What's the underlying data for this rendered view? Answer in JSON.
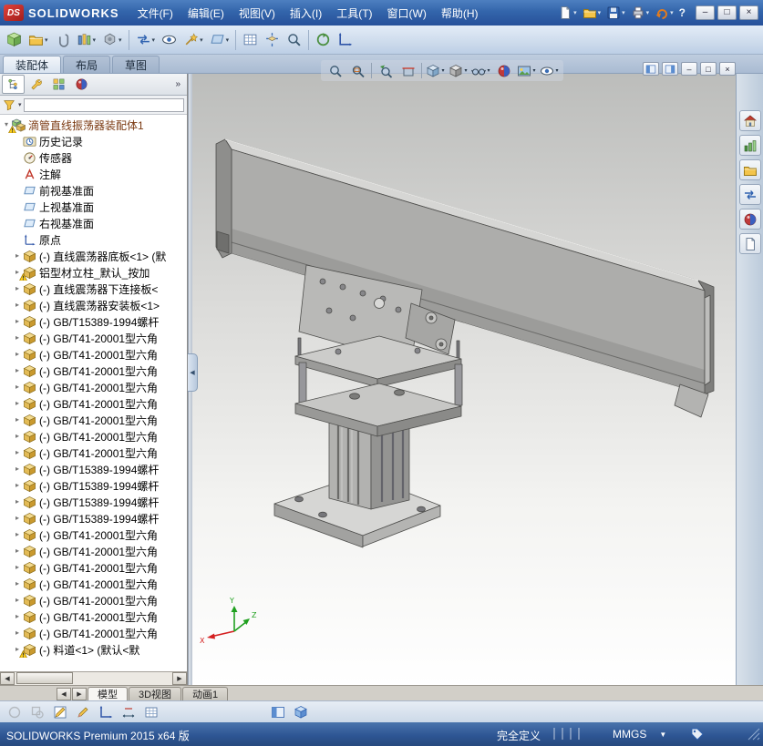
{
  "colors": {
    "titlebar_blue": "#33609f",
    "logo_red": "#cb2b26",
    "toolbar_blue": "#cfdcec",
    "statusbar_blue": "#2f5a99",
    "warning_yellow": "#ffd21e",
    "viewport_gray": "#bcbdbb"
  },
  "glyphs": {
    "dropdown": "▼",
    "dropdown_small": "▾",
    "expander_collapsed": "▸",
    "expander_expanded": "▾",
    "expand_panel": "»",
    "scroll_left": "◀",
    "scroll_right": "▶",
    "collapse_left": "◀",
    "minimize": "–",
    "restore": "□",
    "close": "×",
    "help": "?"
  },
  "title_bar": {
    "logo_badge": "DS",
    "logo_text": "SOLIDWORKS",
    "menus": [
      "文件(F)",
      "编辑(E)",
      "视图(V)",
      "插入(I)",
      "工具(T)",
      "窗口(W)",
      "帮助(H)"
    ],
    "quick_tools": [
      {
        "name": "new-document-icon",
        "icon": "doc",
        "dropdown": true
      },
      {
        "name": "open-icon",
        "icon": "folder",
        "dropdown": true
      },
      {
        "name": "save-icon",
        "icon": "save",
        "dropdown": true
      },
      {
        "name": "print-icon",
        "icon": "printer",
        "dropdown": true
      },
      {
        "name": "undo-icon",
        "icon": "undo",
        "dropdown": true
      },
      {
        "name": "help-icon",
        "glyph": "?"
      }
    ],
    "window_buttons": [
      {
        "name": "minimize-button",
        "glyph": "–"
      },
      {
        "name": "restore-button",
        "glyph": "□"
      },
      {
        "name": "close-button",
        "glyph": "×"
      }
    ]
  },
  "assembly_toolbar": [
    {
      "name": "insert-components-icon",
      "icon": "cubeG"
    },
    {
      "name": "open-component-icon",
      "icon": "folder",
      "dropdown": true
    },
    {
      "name": "mate-icon",
      "icon": "clip"
    },
    {
      "name": "component-pattern-icon",
      "icon": "cols",
      "dropdown": true
    },
    {
      "name": "smart-fasteners-icon",
      "icon": "bolt",
      "dropdown": true
    },
    {
      "sep": true
    },
    {
      "name": "move-component-icon",
      "icon": "arrswap",
      "dropdown": true
    },
    {
      "name": "show-hidden-components-icon",
      "icon": "eye"
    },
    {
      "name": "assembly-features-icon",
      "icon": "wand",
      "dropdown": true
    },
    {
      "name": "reference-geometry-icon",
      "icon": "planeIc",
      "dropdown": true
    },
    {
      "sep": true
    },
    {
      "name": "bill-of-materials-icon",
      "icon": "grid"
    },
    {
      "name": "exploded-view-icon",
      "icon": "explode"
    },
    {
      "name": "interference-detection-icon",
      "icon": "mag"
    },
    {
      "sep": true
    },
    {
      "name": "new-motion-study-icon",
      "icon": "motion"
    },
    {
      "name": "instant3d-icon",
      "icon": "axis"
    }
  ],
  "command_tabs": [
    {
      "label": "装配体",
      "active": true
    },
    {
      "label": "布局",
      "active": false
    },
    {
      "label": "草图",
      "active": false
    }
  ],
  "manager_panel": {
    "tabs": [
      {
        "name": "featuremanager-tab",
        "icon": "fm",
        "active": true
      },
      {
        "name": "propertymanager-tab",
        "icon": "pm",
        "active": false
      },
      {
        "name": "configurationmanager-tab",
        "icon": "cm",
        "active": false
      },
      {
        "name": "displaymanager-tab",
        "icon": "ball",
        "active": false
      }
    ],
    "expand_button": "»"
  },
  "feature_tree": {
    "root": {
      "label": "滴管直线振荡器装配体1",
      "warning": true
    },
    "items": [
      {
        "icon": "clock",
        "label": "历史记录"
      },
      {
        "icon": "gauge",
        "label": "传感器"
      },
      {
        "icon": "annA",
        "label": "注解"
      },
      {
        "icon": "planeIc",
        "label": "前视基准面"
      },
      {
        "icon": "planeIc",
        "label": "上视基准面"
      },
      {
        "icon": "planeIc",
        "label": "右视基准面"
      },
      {
        "icon": "originIc",
        "label": "原点"
      },
      {
        "icon": "part",
        "label": "(-) 直线震荡器底板<1> (默",
        "expander": true
      },
      {
        "icon": "part",
        "label": "铝型材立柱_默认_按加",
        "warning": true,
        "expander": true
      },
      {
        "icon": "part",
        "label": "(-) 直线震荡器下连接板<",
        "expander": true
      },
      {
        "icon": "part",
        "label": "(-) 直线震荡器安装板<1>",
        "expander": true
      },
      {
        "icon": "part",
        "label": "(-) GB/T15389-1994螺杆",
        "expander": true
      },
      {
        "icon": "part",
        "label": "(-) GB/T41-20001型六角",
        "expander": true
      },
      {
        "icon": "part",
        "label": "(-) GB/T41-20001型六角",
        "expander": true
      },
      {
        "icon": "part",
        "label": "(-) GB/T41-20001型六角",
        "expander": true
      },
      {
        "icon": "part",
        "label": "(-) GB/T41-20001型六角",
        "expander": true
      },
      {
        "icon": "part",
        "label": "(-) GB/T41-20001型六角",
        "expander": true
      },
      {
        "icon": "part",
        "label": "(-) GB/T41-20001型六角",
        "expander": true
      },
      {
        "icon": "part",
        "label": "(-) GB/T41-20001型六角",
        "expander": true
      },
      {
        "icon": "part",
        "label": "(-) GB/T41-20001型六角",
        "expander": true
      },
      {
        "icon": "part",
        "label": "(-) GB/T15389-1994螺杆",
        "expander": true
      },
      {
        "icon": "part",
        "label": "(-) GB/T15389-1994螺杆",
        "expander": true
      },
      {
        "icon": "part",
        "label": "(-) GB/T15389-1994螺杆",
        "expander": true
      },
      {
        "icon": "part",
        "label": "(-) GB/T15389-1994螺杆",
        "expander": true
      },
      {
        "icon": "part",
        "label": "(-) GB/T41-20001型六角",
        "expander": true
      },
      {
        "icon": "part",
        "label": "(-) GB/T41-20001型六角",
        "expander": true
      },
      {
        "icon": "part",
        "label": "(-) GB/T41-20001型六角",
        "expander": true
      },
      {
        "icon": "part",
        "label": "(-) GB/T41-20001型六角",
        "expander": true
      },
      {
        "icon": "part",
        "label": "(-) GB/T41-20001型六角",
        "expander": true
      },
      {
        "icon": "part",
        "label": "(-) GB/T41-20001型六角",
        "expander": true
      },
      {
        "icon": "part",
        "label": "(-) GB/T41-20001型六角",
        "expander": true
      },
      {
        "icon": "part",
        "label": "(-) 料道<1> (默认<默",
        "warning": true,
        "expander": true
      }
    ]
  },
  "heads_up_toolbar": [
    {
      "name": "zoom-fit-icon",
      "icon": "mag"
    },
    {
      "name": "zoom-area-icon",
      "icon": "magR"
    },
    {
      "sep": true
    },
    {
      "name": "previous-view-icon",
      "icon": "magA"
    },
    {
      "name": "section-view-icon",
      "icon": "section"
    },
    {
      "sep": true
    },
    {
      "name": "view-orientation-icon",
      "icon": "cubeV",
      "dropdown": true
    },
    {
      "name": "display-style-icon",
      "icon": "cubeS",
      "dropdown": true
    },
    {
      "name": "hide-show-items-icon",
      "icon": "glasses",
      "dropdown": true
    },
    {
      "name": "edit-appearance-icon",
      "icon": "ball"
    },
    {
      "name": "apply-scene-icon",
      "icon": "scene",
      "dropdown": true
    },
    {
      "name": "view-settings-icon",
      "icon": "eye",
      "dropdown": true
    }
  ],
  "document_controls": [
    {
      "name": "pane-preview-icon",
      "icon": "panelblue"
    },
    {
      "name": "pane-split-icon",
      "icon": "panelblue2"
    },
    {
      "name": "doc-minimize-button",
      "glyph": "–"
    },
    {
      "name": "doc-restore-button",
      "glyph": "□"
    },
    {
      "name": "doc-close-button",
      "glyph": "×"
    }
  ],
  "task_pane": [
    {
      "name": "solidworks-resources-tab",
      "icon": "house"
    },
    {
      "name": "design-library-tab",
      "icon": "chart"
    },
    {
      "name": "file-explorer-tab",
      "icon": "folder"
    },
    {
      "name": "view-palette-tab",
      "icon": "arrswap"
    },
    {
      "name": "appearances-scenes-tab",
      "icon": "ball"
    },
    {
      "name": "custom-properties-tab",
      "icon": "doc"
    }
  ],
  "view_tabs": {
    "tabs": [
      {
        "label": "模型",
        "active": true
      },
      {
        "label": "3D视图",
        "active": false
      },
      {
        "label": "动画1",
        "active": false
      }
    ]
  },
  "bottom_toolbar": [
    {
      "name": "sketch-entities-disabled-icon",
      "icon": "circle",
      "disabled": true
    },
    {
      "name": "sketch-tools-disabled-icon",
      "icon": "shapes",
      "disabled": true
    },
    {
      "name": "sketch-icon",
      "icon": "sketch"
    },
    {
      "name": "3d-sketch-icon",
      "icon": "pencil"
    },
    {
      "name": "coordinate-system-icon",
      "icon": "axis"
    },
    {
      "name": "smart-dimension-icon",
      "icon": "dim"
    },
    {
      "name": "grid-snap-icon",
      "icon": "grid"
    },
    {
      "gap": 112
    },
    {
      "name": "task-pane-toggle-icon",
      "icon": "panelblue"
    },
    {
      "name": "display-pane-toggle-icon",
      "icon": "cubeblue"
    }
  ],
  "status_bar": {
    "product": "SOLIDWORKS Premium 2015 x64 版",
    "state": "完全定义",
    "units": "MMGS"
  },
  "viewport": {
    "triad": {
      "x": "X",
      "y": "Y",
      "z": "Z"
    }
  }
}
